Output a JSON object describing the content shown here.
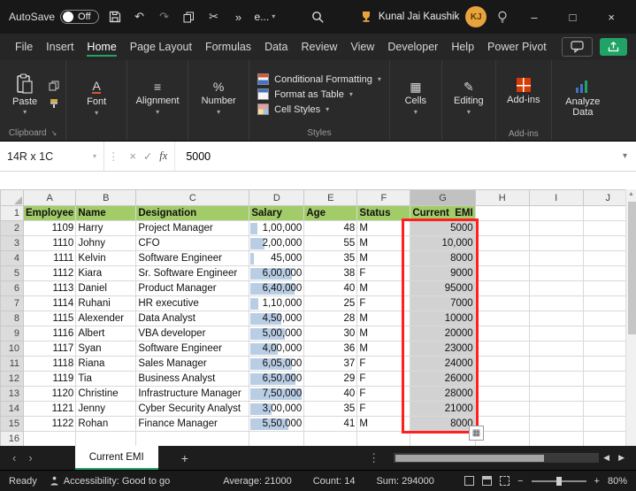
{
  "colors": {
    "excel_green": "#21A366",
    "header_row_green": "#A2CC68",
    "selection_gray": "#D2D2D2",
    "databar_blue": "#B9CDE5",
    "annotation_red": "#FF1F1F",
    "addins_orange": "#D83B01"
  },
  "icons": {
    "chevron_down": "▾",
    "undo": "↶",
    "redo": "↷",
    "cut": "✂",
    "more": "»",
    "minimize": "–",
    "maximize": "□",
    "close": "×",
    "cancel": "×",
    "check": "✓",
    "kebab": "⋮",
    "tab_prev": "‹",
    "tab_next": "›",
    "scroll_left": "◀",
    "scroll_right": "▶",
    "scroll_up": "▲",
    "add_sheet": "+",
    "zoom_out": "−",
    "zoom_in": "+",
    "align": "≡",
    "percent": "%",
    "font": "A",
    "cells": "▦",
    "editing": "✎",
    "launcher": "↘",
    "quick_analysis": "▦"
  },
  "titlebar": {
    "autosave_label": "AutoSave",
    "autosave_state": "Off",
    "doc_menu_label": "e...",
    "user_name": "Kunal Jai Kaushik",
    "user_initials": "KJ"
  },
  "menubar": {
    "tabs": [
      "File",
      "Insert",
      "Home",
      "Page Layout",
      "Formulas",
      "Data",
      "Review",
      "View",
      "Developer",
      "Help",
      "Power Pivot"
    ],
    "active_tab": "Home"
  },
  "ribbon": {
    "paste_label": "Paste",
    "clipboard_group_label": "Clipboard",
    "font_label": "Font",
    "alignment_label": "Alignment",
    "number_label": "Number",
    "styles_items": [
      "Conditional Formatting",
      "Format as Table",
      "Cell Styles"
    ],
    "styles_group_label": "Styles",
    "cells_label": "Cells",
    "editing_label": "Editing",
    "addins_label": "Add-ins",
    "addins_group_label": "Add-ins",
    "analyze_label": "Analyze Data"
  },
  "formula_bar": {
    "name_box": "14R x 1C",
    "fx_label": "fx",
    "value": "5000"
  },
  "sheet": {
    "column_letters": [
      "A",
      "B",
      "C",
      "D",
      "E",
      "F",
      "G",
      "H",
      "I",
      "J"
    ],
    "selected_column": "G",
    "headers": [
      "Employee",
      "Name",
      "Designation",
      "Salary",
      "Age",
      "Status",
      "Current  EMI"
    ],
    "salary_max": 750000,
    "rows": [
      {
        "employee": "1109",
        "name": "Harry",
        "designation": "Project Manager",
        "salary": "1,00,000",
        "salary_value": 100000,
        "age": "48",
        "status": "M",
        "emi": "5000"
      },
      {
        "employee": "1110",
        "name": "Johny",
        "designation": "CFO",
        "salary": "2,00,000",
        "salary_value": 200000,
        "age": "55",
        "status": "M",
        "emi": "10,000"
      },
      {
        "employee": "1111",
        "name": "Kelvin",
        "designation": "Software Engineer",
        "salary": "45,000",
        "salary_value": 45000,
        "age": "35",
        "status": "M",
        "emi": "8000"
      },
      {
        "employee": "1112",
        "name": "Kiara",
        "designation": "Sr. Software Engineer",
        "salary": "6,00,000",
        "salary_value": 600000,
        "age": "38",
        "status": "F",
        "emi": "9000"
      },
      {
        "employee": "1113",
        "name": "Daniel",
        "designation": "Product Manager",
        "salary": "6,40,000",
        "salary_value": 640000,
        "age": "40",
        "status": "M",
        "emi": "95000"
      },
      {
        "employee": "1114",
        "name": "Ruhani",
        "designation": "HR executive",
        "salary": "1,10,000",
        "salary_value": 110000,
        "age": "25",
        "status": "F",
        "emi": "7000"
      },
      {
        "employee": "1115",
        "name": "Alexender",
        "designation": "Data Analyst",
        "salary": "4,50,000",
        "salary_value": 450000,
        "age": "28",
        "status": "M",
        "emi": "10000"
      },
      {
        "employee": "1116",
        "name": "Albert",
        "designation": "VBA developer",
        "salary": "5,00,000",
        "salary_value": 500000,
        "age": "30",
        "status": "M",
        "emi": "20000"
      },
      {
        "employee": "1117",
        "name": "Syan",
        "designation": "Software Engineer",
        "salary": "4,00,000",
        "salary_value": 400000,
        "age": "36",
        "status": "M",
        "emi": "23000"
      },
      {
        "employee": "1118",
        "name": "Riana",
        "designation": "Sales Manager",
        "salary": "6,05,000",
        "salary_value": 605000,
        "age": "37",
        "status": "F",
        "emi": "24000"
      },
      {
        "employee": "1119",
        "name": "Tia",
        "designation": "Business Analyst",
        "salary": "6,50,000",
        "salary_value": 650000,
        "age": "29",
        "status": "F",
        "emi": "26000"
      },
      {
        "employee": "1120",
        "name": "Christine",
        "designation": "Infrastructure Manager",
        "salary": "7,50,000",
        "salary_value": 750000,
        "age": "40",
        "status": "F",
        "emi": "28000"
      },
      {
        "employee": "1121",
        "name": "Jenny",
        "designation": "Cyber Security Analyst",
        "salary": "3,00,000",
        "salary_value": 300000,
        "age": "35",
        "status": "F",
        "emi": "21000"
      },
      {
        "employee": "1122",
        "name": "Rohan",
        "designation": "Finance Manager",
        "salary": "5,50,000",
        "salary_value": 550000,
        "age": "41",
        "status": "M",
        "emi": "8000"
      }
    ]
  },
  "tabbar": {
    "active_sheet": "Current EMI"
  },
  "statusbar": {
    "mode": "Ready",
    "accessibility": "Accessibility: Good to go",
    "average": "Average: 21000",
    "count": "Count: 14",
    "sum": "Sum: 294000",
    "zoom": "80%"
  }
}
